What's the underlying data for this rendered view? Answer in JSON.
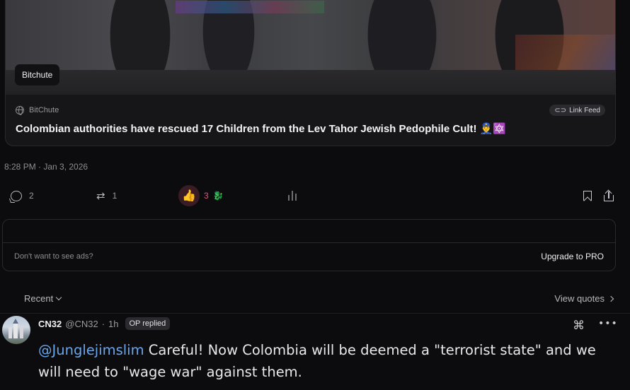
{
  "link_card": {
    "source_badge": "Bitchute",
    "site_name": "BitChute",
    "link_feed_label": "Link Feed",
    "title": "Colombian authorities have rescued 17 Children from the Lev Tahor Jewish Pedophile Cult! 👮‍♂️🔯"
  },
  "post": {
    "timestamp": "8:28 PM · Jan 3, 2026",
    "actions": {
      "comments_count": "2",
      "reposts_count": "1",
      "like_emoji": "👍",
      "reactions_count": "3",
      "extra_reaction_emoji": "🐉"
    }
  },
  "ad_box": {
    "no_ads_text": "Don't want to see ads?",
    "upgrade_label": "Upgrade to PRO"
  },
  "comments": {
    "sort_label": "Recent",
    "view_quotes_label": "View quotes",
    "items": [
      {
        "display_name": "CN32",
        "handle": "@CN32",
        "age": "1h",
        "badge": "OP replied",
        "mention": "@Junglejimslim",
        "text": " Careful!  Now Colombia will be deemed a \"terrorist state\" and we will need to \"wage war\" against them."
      }
    ]
  },
  "colors": {
    "background": "#0c0c0e",
    "accent_link": "#6aa6ec",
    "reaction_pink": "#e05577"
  }
}
